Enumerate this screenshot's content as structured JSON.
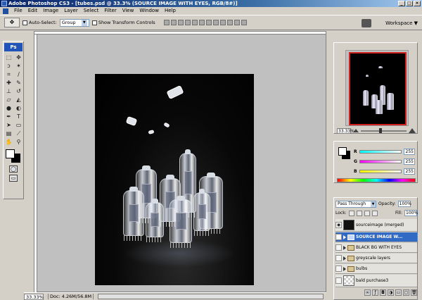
{
  "window": {
    "title": "Adobe Photoshop CS3 - [tubes.psd @ 33.3% (SOURCE IMAGE WITH EYES, RGB/8#)]",
    "minimize": "_",
    "maximize": "□",
    "close": "×"
  },
  "menu": {
    "items": [
      "File",
      "Edit",
      "Image",
      "Layer",
      "Select",
      "Filter",
      "View",
      "Window",
      "Help"
    ]
  },
  "options": {
    "auto_select_label": "Auto-Select:",
    "auto_select_value": "Group",
    "show_transform_label": "Show Transform Controls",
    "workspace_label": "Workspace ▼"
  },
  "toolbox": {
    "badge": "Ps"
  },
  "status": {
    "zoom": "33.33%",
    "doc": "Doc: 4.26M/56.8M"
  },
  "navigator": {
    "zoom": "33.33%"
  },
  "color": {
    "r_label": "R",
    "r_value": "255",
    "g_label": "G",
    "g_value": "255",
    "b_label": "B",
    "b_value": "255",
    "r_gradient": "#00e0e0",
    "g_gradient": "#ff00ff",
    "b_gradient": "#ffff00"
  },
  "layers": {
    "blend_mode": "Pass Through",
    "opacity_label": "Opacity:",
    "opacity_value": "100%",
    "lock_label": "Lock:",
    "fill_label": "Fill:",
    "fill_value": "100%",
    "rows": [
      {
        "name": "sourceimage (merged)",
        "visible": true
      },
      {
        "name": "SOURCE IMAGE W...",
        "visible": true,
        "selected": true
      },
      {
        "name": "BLACK BG WITH EYES",
        "visible": false
      },
      {
        "name": "greyscale layers",
        "visible": false
      },
      {
        "name": "bulbs",
        "visible": false
      },
      {
        "name": "bald purchase3",
        "visible": false
      }
    ]
  }
}
